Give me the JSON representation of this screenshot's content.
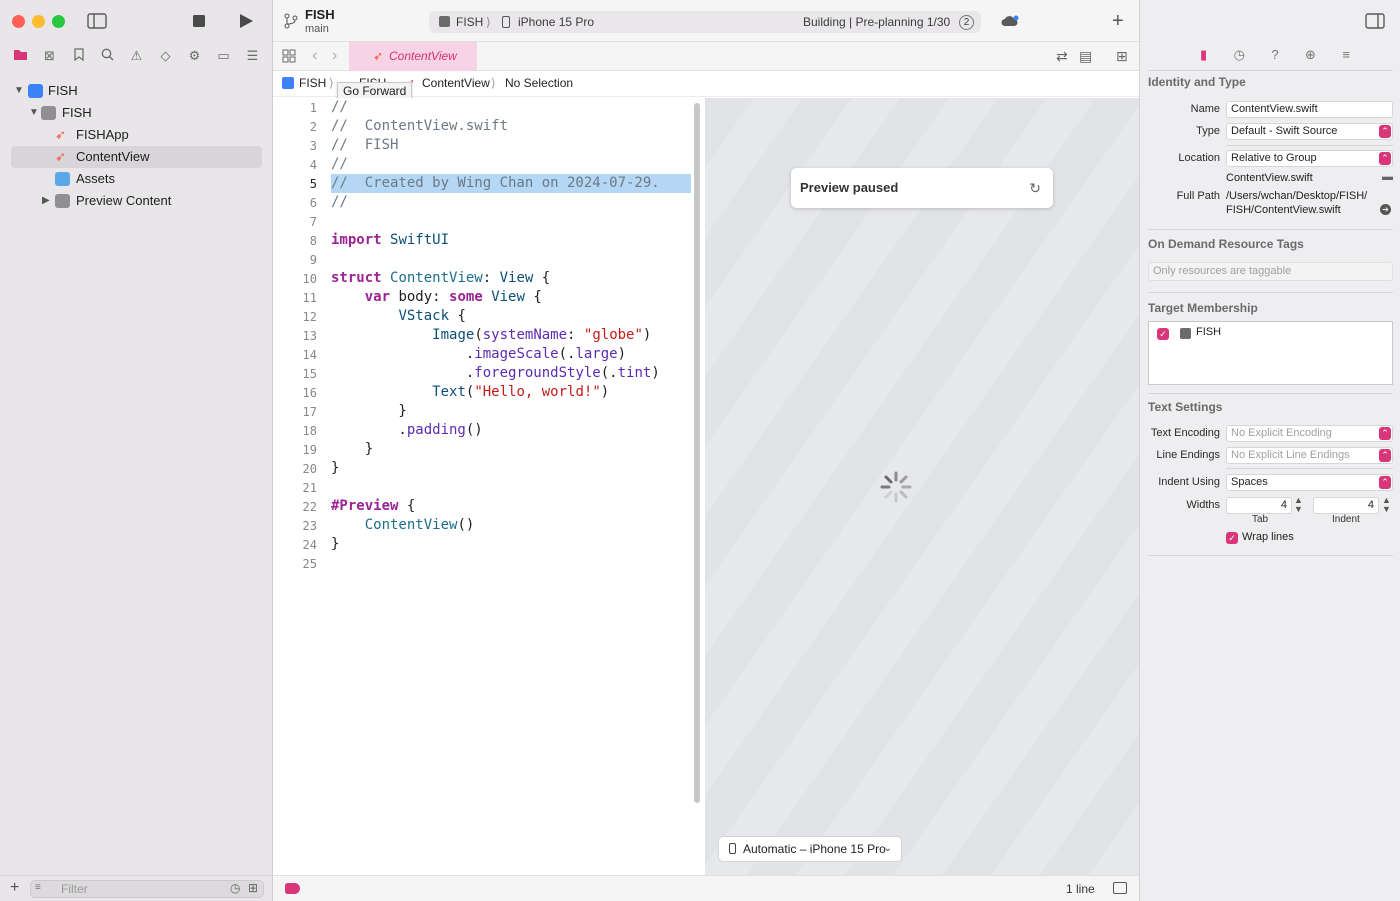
{
  "toolbar": {
    "project_name": "FISH",
    "branch": "main",
    "scheme": "FISH",
    "destination": "iPhone 15 Pro",
    "status": "Building | Pre-planning 1/30",
    "issue_count": "2"
  },
  "tab": {
    "label": "ContentView"
  },
  "jumpbar": {
    "project": "FISH",
    "group": "FISH",
    "file": "ContentView",
    "selection": "No Selection"
  },
  "tooltip": "Go Forward",
  "navigator": {
    "items": [
      {
        "label": "FISH"
      },
      {
        "label": "FISH"
      },
      {
        "label": "FISHApp"
      },
      {
        "label": "ContentView"
      },
      {
        "label": "Assets"
      },
      {
        "label": "Preview Content"
      }
    ],
    "filter_placeholder": "Filter"
  },
  "code": {
    "line_numbers": [
      "1",
      "2",
      "3",
      "4",
      "5",
      "6",
      "7",
      "8",
      "9",
      "10",
      "11",
      "12",
      "13",
      "14",
      "15",
      "16",
      "17",
      "18",
      "19",
      "20",
      "21",
      "22",
      "23",
      "24",
      "25"
    ],
    "lines": [
      "//",
      "//  ContentView.swift",
      "//  FISH",
      "//",
      "//  Created by Wing Chan on 2024-07-29.",
      "//",
      "",
      "import SwiftUI",
      "",
      "struct ContentView: View {",
      "    var body: some View {",
      "        VStack {",
      "            Image(systemName: \"globe\")",
      "                .imageScale(.large)",
      "                .foregroundStyle(.tint)",
      "            Text(\"Hello, world!\")",
      "        }",
      "        .padding()",
      "    }",
      "}",
      "",
      "#Preview {",
      "    ContentView()",
      "}",
      ""
    ]
  },
  "preview": {
    "paused_label": "Preview paused",
    "device_label": "Automatic – iPhone 15 Pro"
  },
  "statusbar": {
    "line_count": "1 line"
  },
  "inspector": {
    "identity_title": "Identity and Type",
    "name_label": "Name",
    "name_value": "ContentView.swift",
    "type_label": "Type",
    "type_value": "Default - Swift Source",
    "location_label": "Location",
    "location_value": "Relative to Group",
    "location_file": "ContentView.swift",
    "fullpath_label": "Full Path",
    "fullpath_line1": "/Users/wchan/Desktop/FISH/",
    "fullpath_line2": "FISH/ContentView.swift",
    "odr_title": "On Demand Resource Tags",
    "odr_placeholder": "Only resources are taggable",
    "target_title": "Target Membership",
    "target_name": "FISH",
    "text_title": "Text Settings",
    "encoding_label": "Text Encoding",
    "encoding_value": "No Explicit Encoding",
    "endings_label": "Line Endings",
    "endings_value": "No Explicit Line Endings",
    "indent_label": "Indent Using",
    "indent_value": "Spaces",
    "widths_label": "Widths",
    "tab_width": "4",
    "indent_width": "4",
    "tab_caption": "Tab",
    "indent_caption": "Indent",
    "wrap_label": "Wrap lines"
  }
}
